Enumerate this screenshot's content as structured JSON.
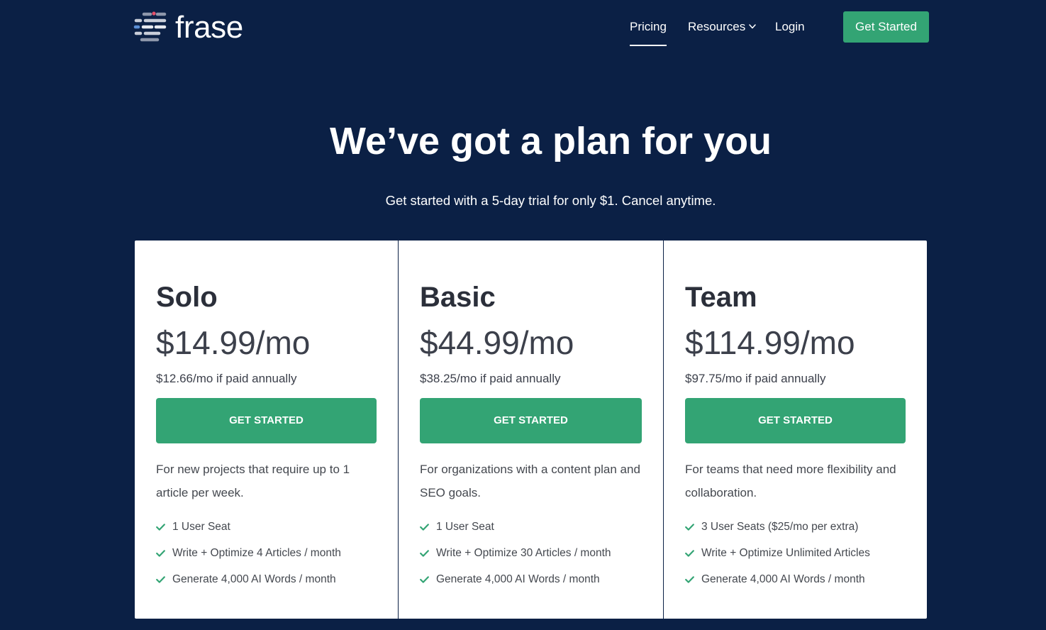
{
  "brand": {
    "name": "frase",
    "logo_icon": "frase-logo-icon"
  },
  "nav": {
    "items": [
      {
        "label": "Pricing",
        "active": true
      },
      {
        "label": "Resources",
        "has_dropdown": true,
        "icon": "chevron-down-icon"
      },
      {
        "label": "Login"
      }
    ],
    "cta_label": "Get Started"
  },
  "hero": {
    "title": "We’ve got a plan for you",
    "subtitle": "Get started with a 5-day trial for only $1. Cancel anytime."
  },
  "plans": [
    {
      "name": "Solo",
      "price": "$14.99/mo",
      "annual_price": "$12.66/mo if paid annually",
      "cta_label": "GET STARTED",
      "description_lines": [
        "For new projects that require up to 1",
        "article per week."
      ],
      "features": [
        "1 User Seat",
        "Write + Optimize 4 Articles / month",
        "Generate 4,000 AI Words / month"
      ]
    },
    {
      "name": "Basic",
      "price": "$44.99/mo",
      "annual_price": "$38.25/mo if paid annually",
      "cta_label": "GET STARTED",
      "description_lines": [
        "For organizations with a content plan and",
        "SEO goals."
      ],
      "features": [
        "1 User Seat",
        "Write + Optimize 30 Articles / month",
        "Generate 4,000 AI Words / month"
      ]
    },
    {
      "name": "Team",
      "price": "$114.99/mo",
      "annual_price": "$97.75/mo if paid annually",
      "cta_label": "GET STARTED",
      "description_lines": [
        "For teams that need more flexibility and",
        "collaboration."
      ],
      "features": [
        "3 User Seats ($25/mo per extra)",
        "Write + Optimize Unlimited Articles",
        "Generate 4,000 AI Words / month"
      ]
    }
  ],
  "feature_icon": "check-icon",
  "colors": {
    "background": "#0b2045",
    "accent": "#33a474",
    "card_background": "#ffffff",
    "heading_text": "#2b2f3a",
    "body_text": "#3c404b"
  }
}
